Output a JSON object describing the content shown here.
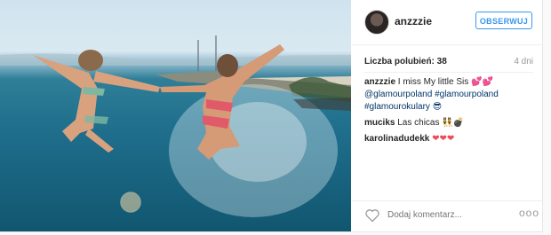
{
  "post": {
    "username": "anzzzie",
    "follow_label": "OBSERWUJ",
    "likes_label": "Liczba polubień:",
    "likes_count": "38",
    "time_ago": "4 dni"
  },
  "comments": [
    {
      "user": "anzzzie",
      "text": "I miss My little Sis 💕💕",
      "tags": "@glamourpoland #glamourpoland #glamourokulary 😎"
    },
    {
      "user": "muciks",
      "text": "Las chicas 👯💣"
    },
    {
      "user": "karolinadudekk",
      "text": "❤❤❤"
    }
  ],
  "footer": {
    "add_comment_placeholder": "Dodaj komentarz...",
    "more_label": "ooo"
  },
  "icons": {
    "like": "heart-icon",
    "more": "more-options-icon",
    "avatar": "avatar"
  },
  "colors": {
    "accent": "#3897f0",
    "hashtag": "#003569",
    "heart_red": "#ed4956"
  }
}
